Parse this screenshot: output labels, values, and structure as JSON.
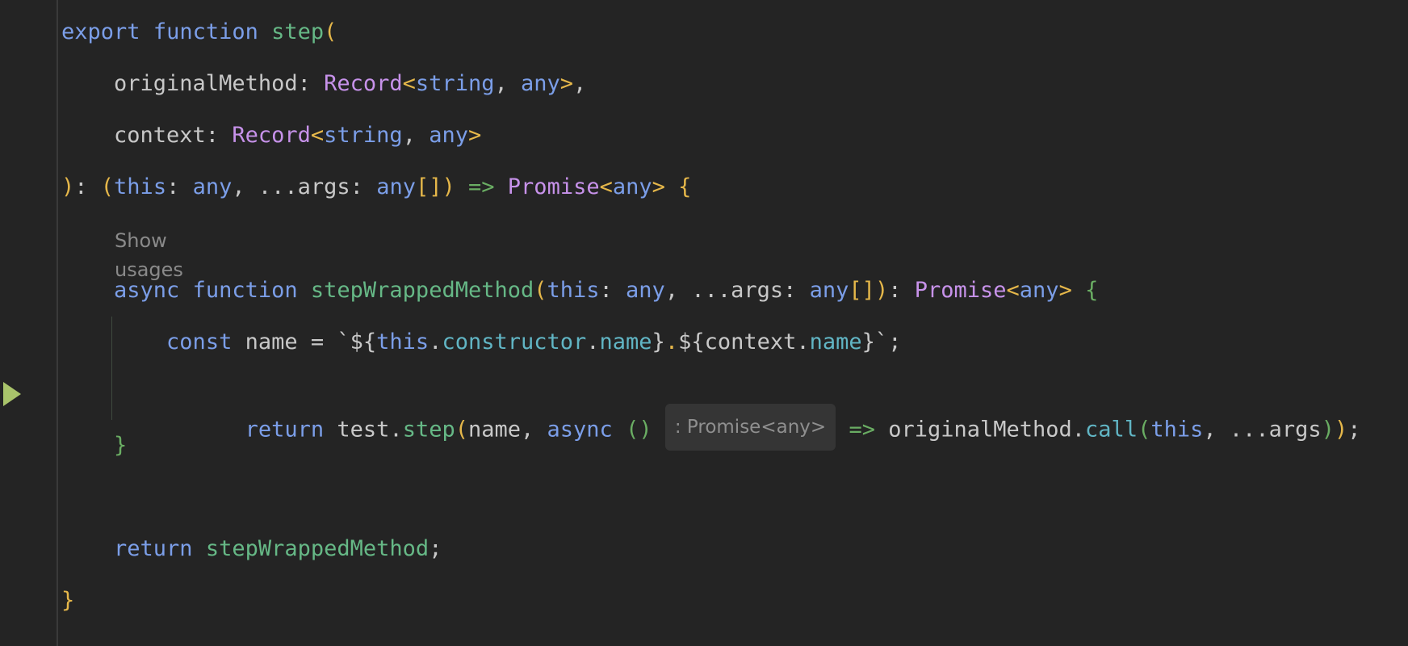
{
  "editor": {
    "lines": [
      [
        [
          "export",
          "kw"
        ],
        [
          " ",
          "punc"
        ],
        [
          "function",
          "kw"
        ],
        [
          " ",
          "punc"
        ],
        [
          "step",
          "fn"
        ],
        [
          "(",
          "y"
        ]
      ],
      [
        [
          "    originalMethod: ",
          "punc"
        ],
        [
          "Record",
          "type"
        ],
        [
          "<",
          "y"
        ],
        [
          "string",
          "kw"
        ],
        [
          ", ",
          "punc"
        ],
        [
          "any",
          "kw"
        ],
        [
          ">",
          "y"
        ],
        [
          ",",
          "punc"
        ]
      ],
      [
        [
          "    context: ",
          "punc"
        ],
        [
          "Record",
          "type"
        ],
        [
          "<",
          "y"
        ],
        [
          "string",
          "kw"
        ],
        [
          ", ",
          "punc"
        ],
        [
          "any",
          "kw"
        ],
        [
          ">",
          "y"
        ]
      ],
      [
        [
          ")",
          "y"
        ],
        [
          ": ",
          "punc"
        ],
        [
          "(",
          "y"
        ],
        [
          "this",
          "kw"
        ],
        [
          ": ",
          "punc"
        ],
        [
          "any",
          "kw"
        ],
        [
          ", ...args: ",
          "punc"
        ],
        [
          "any",
          "kw"
        ],
        [
          "[]",
          "y"
        ],
        [
          ")",
          "y"
        ],
        [
          " ",
          "punc"
        ],
        [
          "=>",
          "g"
        ],
        [
          " ",
          "punc"
        ],
        [
          "Promise",
          "type"
        ],
        [
          "<",
          "y"
        ],
        [
          "any",
          "kw"
        ],
        [
          "> ",
          "y"
        ],
        [
          "{",
          "y"
        ]
      ],
      [
        [
          "    ",
          "punc"
        ],
        [
          "async",
          "kw"
        ],
        [
          " ",
          "punc"
        ],
        [
          "function",
          "kw"
        ],
        [
          " ",
          "punc"
        ],
        [
          "stepWrappedMethod",
          "fn"
        ],
        [
          "(",
          "y"
        ],
        [
          "this",
          "kw"
        ],
        [
          ": ",
          "punc"
        ],
        [
          "any",
          "kw"
        ],
        [
          ", ...args: ",
          "punc"
        ],
        [
          "any",
          "kw"
        ],
        [
          "[]",
          "y"
        ],
        [
          ")",
          "y"
        ],
        [
          ": ",
          "punc"
        ],
        [
          "Promise",
          "type"
        ],
        [
          "<",
          "y"
        ],
        [
          "any",
          "kw"
        ],
        [
          "> ",
          "y"
        ],
        [
          "{",
          "g"
        ]
      ],
      [
        [
          "        ",
          "punc"
        ],
        [
          "const",
          "kw"
        ],
        [
          " name = `${",
          "str"
        ],
        [
          "this",
          "kw"
        ],
        [
          ".",
          "punc"
        ],
        [
          "constructor",
          "prop"
        ],
        [
          ".",
          "punc"
        ],
        [
          "name",
          "prop"
        ],
        [
          "}",
          "str"
        ],
        [
          ".",
          "y"
        ],
        [
          "${context.",
          "str"
        ],
        [
          "name",
          "prop"
        ],
        [
          "}`",
          "str"
        ],
        [
          ";",
          "punc"
        ]
      ],
      [
        [
          "        ",
          "punc"
        ],
        [
          "return",
          "kw"
        ],
        [
          " test.",
          "punc"
        ],
        [
          "step",
          "fn"
        ],
        [
          "(",
          "y"
        ],
        [
          "name, ",
          "punc"
        ],
        [
          "async",
          "kw"
        ],
        [
          " ",
          "punc"
        ],
        [
          "()",
          "g"
        ],
        [
          " ",
          "punc"
        ]
      ],
      [
        [
          "    ",
          "punc"
        ],
        [
          "}",
          "g"
        ]
      ],
      [
        [
          "    ",
          "punc"
        ],
        [
          "return",
          "kw"
        ],
        [
          " ",
          "punc"
        ],
        [
          "stepWrappedMethod",
          "fn"
        ],
        [
          ";",
          "punc"
        ]
      ],
      [
        [
          "}",
          "y"
        ]
      ]
    ],
    "return_line_tail": [
      [
        " ",
        "punc"
      ],
      [
        "=>",
        "g"
      ],
      [
        " originalMethod.",
        "punc"
      ],
      [
        "call",
        "prop"
      ],
      [
        "(",
        "g"
      ],
      [
        "this",
        "kw"
      ],
      [
        ", ...args",
        "punc"
      ],
      [
        ")",
        "g"
      ],
      [
        ")",
        "y"
      ],
      [
        ";",
        "punc"
      ]
    ],
    "show_usages_hint": "Show usages",
    "inlay_hint": ": Promise<any>"
  },
  "colors": {
    "background": "#242424",
    "keyword": "#7b9ee8",
    "function": "#66b886",
    "type": "#c792ea",
    "property": "#61b5c4",
    "bracket_yellow": "#e5b74a",
    "bracket_green": "#6aad63",
    "run_marker": "#a9c46b"
  }
}
